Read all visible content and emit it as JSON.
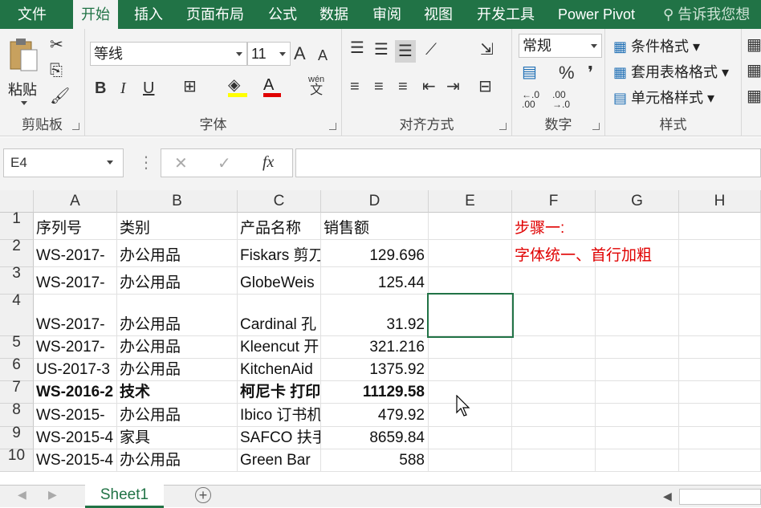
{
  "tabs": [
    "文件",
    "开始",
    "插入",
    "页面布局",
    "公式",
    "数据",
    "审阅",
    "视图",
    "开发工具",
    "Power Pivot"
  ],
  "tell_me": "告诉我您想",
  "clipboard": {
    "paste": "粘贴",
    "label": "剪贴板"
  },
  "font": {
    "name": "等线",
    "size": "11",
    "label": "字体",
    "bold": "B",
    "italic": "I",
    "underline": "U",
    "grow": "A",
    "shrink": "A",
    "phonetic_top": "wén",
    "phonetic_bottom": "文"
  },
  "alignment": {
    "label": "对齐方式"
  },
  "number": {
    "format": "常规",
    "percent": "%",
    "comma": "❜",
    "label": "数字",
    "inc_top": "←.0",
    "inc_bottom": ".00",
    "dec_top": ".00",
    "dec_bottom": "→.0"
  },
  "styles": {
    "conditional": "条件格式",
    "table": "套用表格格式",
    "cell": "单元格样式",
    "label": "样式"
  },
  "formula_bar": {
    "name_box": "E4",
    "cancel": "✕",
    "enter": "✓",
    "fx": "fx",
    "value": ""
  },
  "columns": [
    "A",
    "B",
    "C",
    "D",
    "E",
    "F",
    "G",
    "H"
  ],
  "rows": [
    {
      "num": "1",
      "a": "序列号",
      "b": "类别",
      "c": "产品名称",
      "d": "销售额",
      "f": "步骤一:"
    },
    {
      "num": "2",
      "a": "WS-2017-",
      "b": "办公用品",
      "c": "Fiskars 剪刀",
      "d": "129.696",
      "f": "字体统一、首行加粗"
    },
    {
      "num": "3",
      "a": "WS-2017-",
      "b": "办公用品",
      "c": "GlobeWeis",
      "d": "125.44",
      "f": ""
    },
    {
      "num": "4",
      "a": "WS-2017-",
      "b": "办公用品",
      "c": "Cardinal 孔",
      "d": "31.92",
      "f": ""
    },
    {
      "num": "5",
      "a": "WS-2017-",
      "b": "办公用品",
      "c": "Kleencut 开",
      "d": "321.216",
      "f": ""
    },
    {
      "num": "6",
      "a": "US-2017-3",
      "b": "办公用品",
      "c": "KitchenAid",
      "d": "1375.92",
      "f": ""
    },
    {
      "num": "7",
      "a": "WS-2016-2",
      "b": "技术",
      "c": "柯尼卡 打印",
      "d": "11129.58",
      "f": ""
    },
    {
      "num": "8",
      "a": "WS-2015-",
      "b": "办公用品",
      "c": "Ibico 订书机",
      "d": "479.92",
      "f": ""
    },
    {
      "num": "9",
      "a": "WS-2015-4",
      "b": "家具",
      "c": "SAFCO 扶手",
      "d": "8659.84",
      "f": ""
    },
    {
      "num": "10",
      "a": "WS-2015-4",
      "b": "办公用品",
      "c": "Green Bar",
      "d": "588",
      "f": ""
    }
  ],
  "sheet": {
    "name": "Sheet1",
    "add": "+"
  },
  "colors": {
    "accent": "#217346",
    "note": "#e00000"
  }
}
